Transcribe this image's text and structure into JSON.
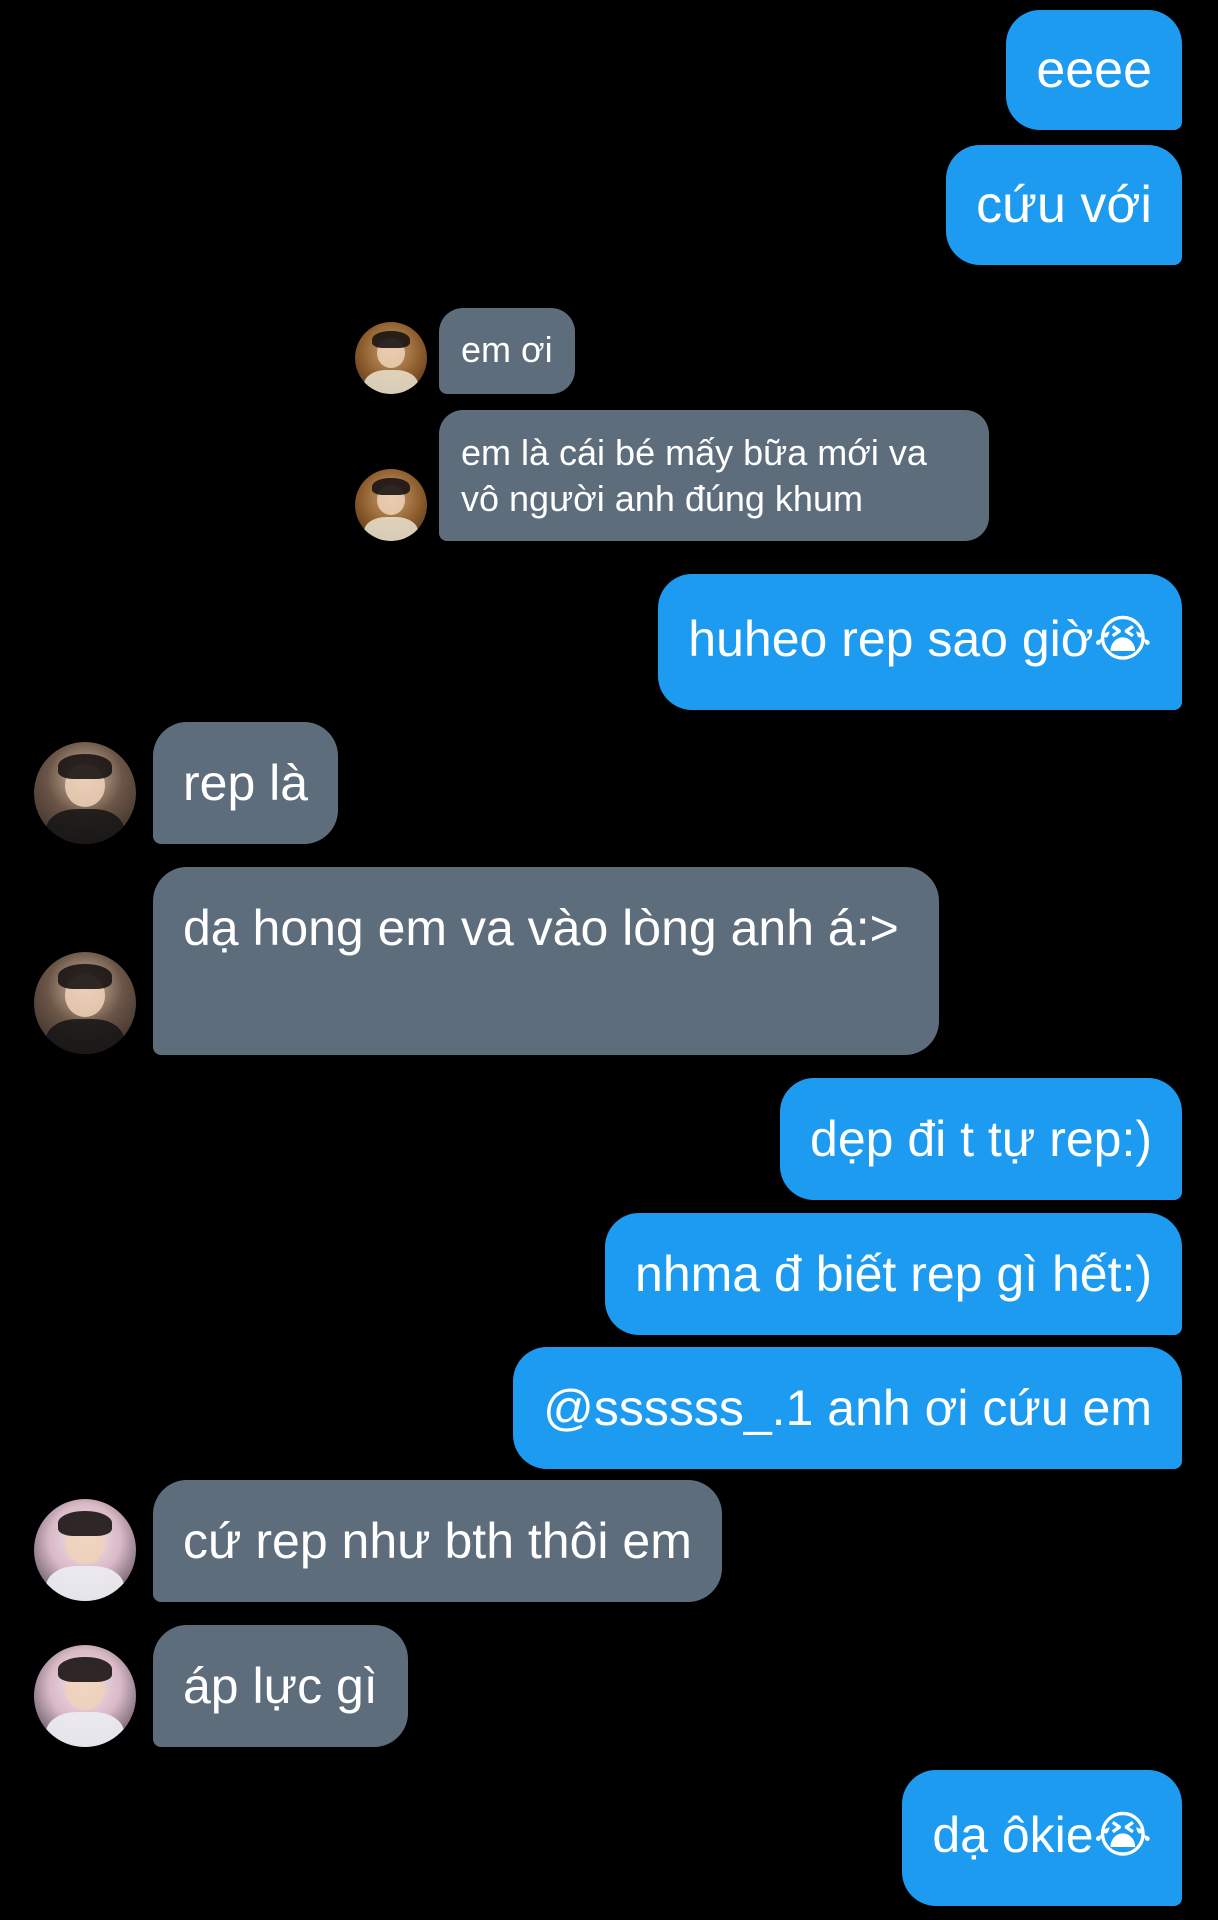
{
  "conversation": {
    "messages": [
      {
        "sender": "me",
        "text": "eeee"
      },
      {
        "sender": "me",
        "text": "cứu với"
      },
      {
        "sender": "user-a",
        "text": "em ơi"
      },
      {
        "sender": "user-a",
        "text": "em là cái bé mấy bữa mới va vô người anh đúng khum"
      },
      {
        "sender": "me",
        "text": "huheo rep sao giờ😭"
      },
      {
        "sender": "user-b",
        "text": "rep là"
      },
      {
        "sender": "user-b",
        "text": "dạ hong em va vào lòng anh á:>"
      },
      {
        "sender": "me",
        "text": "dẹp đi t tự rep:)"
      },
      {
        "sender": "me",
        "text": "nhma đ biết rep gì hết:)"
      },
      {
        "sender": "me",
        "text": "@ssssss_.1 anh ơi cứu em"
      },
      {
        "sender": "user-c",
        "text": "cứ rep như bth thôi em"
      },
      {
        "sender": "user-c",
        "text": "áp lực gì"
      },
      {
        "sender": "me",
        "text": "dạ ôkie😭"
      }
    ]
  },
  "colors": {
    "background": "#000000",
    "outgoing_bubble": "#1d9bf0",
    "incoming_bubble": "#5e6d7c",
    "text": "#ffffff"
  }
}
